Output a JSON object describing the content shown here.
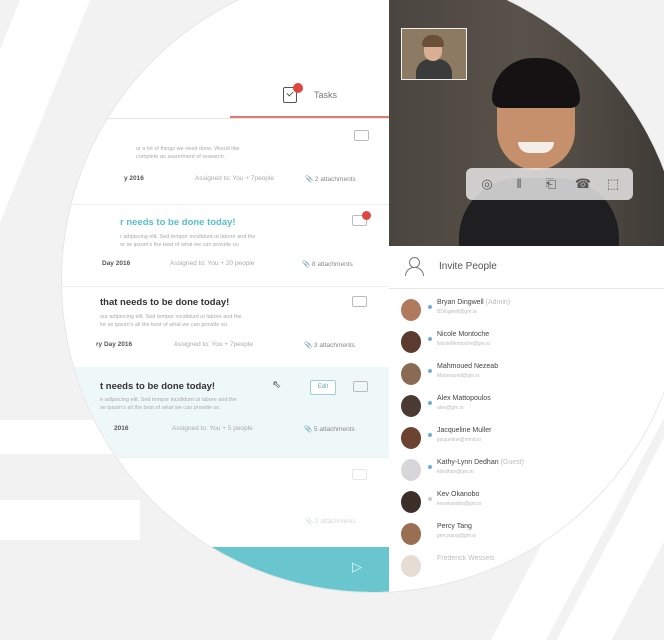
{
  "tabs": {
    "tasks_label": "Tasks"
  },
  "tasks": [
    {
      "title": "",
      "desc1": "ur a lot of things we need done. Would like",
      "desc2": "complete an assortment of research.",
      "date": "y 2016",
      "assigned": "Assigned to: You + 7people",
      "attachments": "2 attachments"
    },
    {
      "title": "r needs to be done today!",
      "desc1": "r adipiscing elit. Sed tempor incididunt ut labore and the",
      "desc2": "or se ipsum's the best of what we can provide ou",
      "date": "Day 2016",
      "assigned": "Assigned to: You + 20 people",
      "attachments": "8 attachments"
    },
    {
      "title": "that needs to be done today!",
      "desc1": "our adipiscing elit. Sed tempor incididunt ut labore and the",
      "desc2": "lor se ipsum's all the best of what we can provide ou",
      "date": "ry Day 2016",
      "assigned": "Assigned to: You + 7people",
      "attachments": "3 attachments"
    },
    {
      "title": "t needs to be done today!",
      "desc1": "e adipiscing elit. Sed tempor incididunt ut labore and the",
      "desc2": "se ipsum's all the best of what we can provide ou",
      "date": "2016",
      "assigned": "Assigned to: You + 5 people",
      "attachments": "5 attachments",
      "edit_label": "Edit"
    },
    {
      "title": "",
      "desc1": "",
      "desc2": "",
      "date": "",
      "assigned": "",
      "attachments": "2 attachments"
    }
  ],
  "invite": {
    "title": "Invite People"
  },
  "people": [
    {
      "name": "Bryan Dingwell",
      "extra": " (Admin)",
      "sub": "BDingwell@gm.io"
    },
    {
      "name": "Nicole Montoche",
      "extra": "",
      "sub": "NicoleMontoche@gm.io"
    },
    {
      "name": "Mahmoued Nezeab",
      "extra": "",
      "sub": "Mahmoued@gm.io"
    },
    {
      "name": "Alex Mattopoulos",
      "extra": "",
      "sub": "alex@gm.io"
    },
    {
      "name": "Jacqueline Muller",
      "extra": "",
      "sub": "jacqueline@mmd.io"
    },
    {
      "name": "Kathy-Lynn Dedhan",
      "extra": " (Guest)",
      "sub": "kdedhan@gm.io"
    },
    {
      "name": "Kev Okanobo",
      "extra": "",
      "sub": "kevokanobo@gm.io"
    },
    {
      "name": "Percy Tang",
      "extra": "",
      "sub": "percytang@gm.io"
    },
    {
      "name": "Frederick Wessels",
      "extra": "",
      "sub": ""
    }
  ],
  "colors": {
    "accent_teal": "#69c5ce",
    "badge_red": "#e0453f",
    "tab_line": "#e27a74"
  }
}
